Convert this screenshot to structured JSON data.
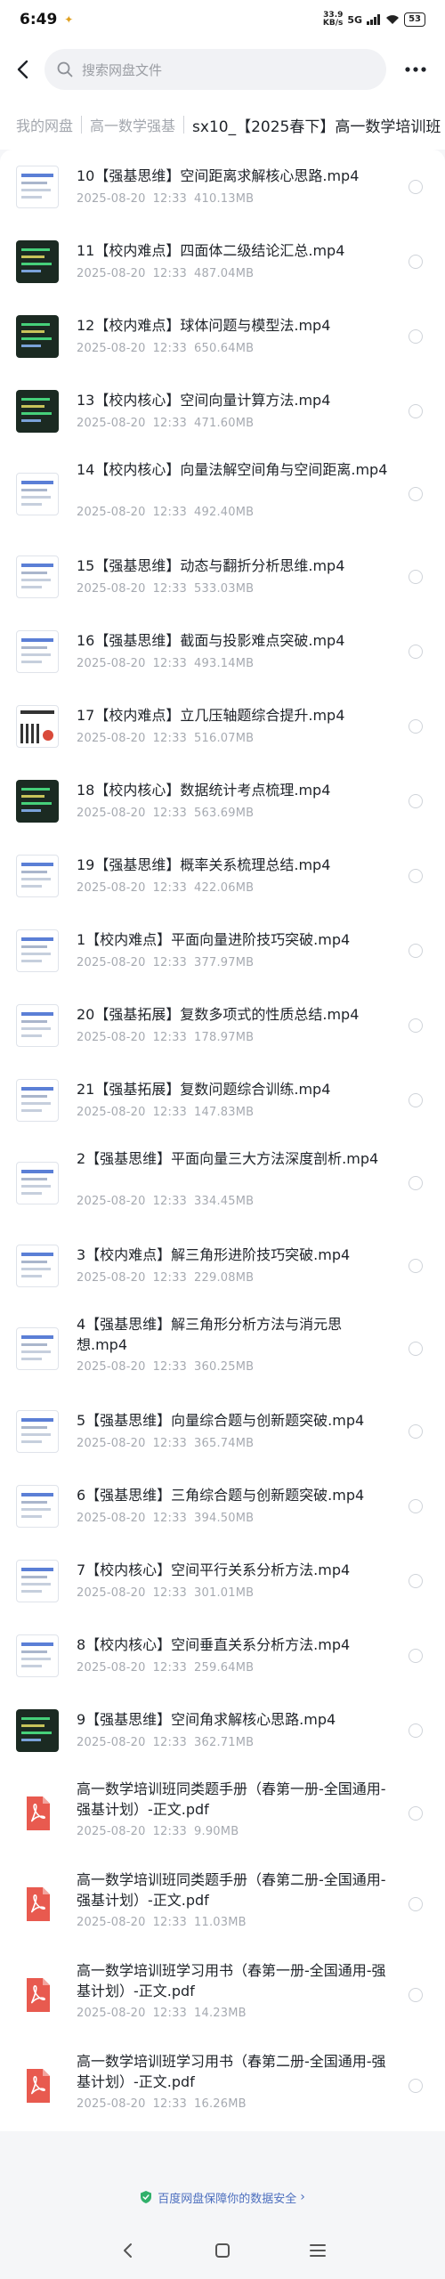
{
  "status": {
    "time": "6:49",
    "net_speed_top": "33.9",
    "net_speed_bottom": "KB/s",
    "signal": "5G",
    "battery": "53"
  },
  "search": {
    "placeholder": "搜索网盘文件"
  },
  "breadcrumb": {
    "items": [
      "我的网盘",
      "高一数学强基"
    ],
    "current": "sx10_【2025春下】高一数学培训班"
  },
  "files": [
    {
      "name": "10【强基思维】空间距离求解核心思路.mp4",
      "date": "2025-08-20",
      "time": "12:33",
      "size": "410.13MB",
      "thumb": "doc"
    },
    {
      "name": "11【校内难点】四面体二级结论汇总.mp4",
      "date": "2025-08-20",
      "time": "12:33",
      "size": "487.04MB",
      "thumb": "dark"
    },
    {
      "name": "12【校内难点】球体问题与模型法.mp4",
      "date": "2025-08-20",
      "time": "12:33",
      "size": "650.64MB",
      "thumb": "dark"
    },
    {
      "name": "13【校内核心】空间向量计算方法.mp4",
      "date": "2025-08-20",
      "time": "12:33",
      "size": "471.60MB",
      "thumb": "dark"
    },
    {
      "name": "14【校内核心】向量法解空间角与空间距离.mp4",
      "date": "2025-08-20",
      "time": "12:33",
      "size": "492.40MB",
      "thumb": "doc"
    },
    {
      "name": "15【强基思维】动态与翻折分析思维.mp4",
      "date": "2025-08-20",
      "time": "12:33",
      "size": "533.03MB",
      "thumb": "doc"
    },
    {
      "name": "16【强基思维】截面与投影难点突破.mp4",
      "date": "2025-08-20",
      "time": "12:33",
      "size": "493.14MB",
      "thumb": "doc"
    },
    {
      "name": "17【校内难点】立几压轴题综合提升.mp4",
      "date": "2025-08-20",
      "time": "12:33",
      "size": "516.07MB",
      "thumb": "qr"
    },
    {
      "name": "18【校内核心】数据统计考点梳理.mp4",
      "date": "2025-08-20",
      "time": "12:33",
      "size": "563.69MB",
      "thumb": "dark"
    },
    {
      "name": "19【强基思维】概率关系梳理总结.mp4",
      "date": "2025-08-20",
      "time": "12:33",
      "size": "422.06MB",
      "thumb": "doc"
    },
    {
      "name": "1【校内难点】平面向量进阶技巧突破.mp4",
      "date": "2025-08-20",
      "time": "12:33",
      "size": "377.97MB",
      "thumb": "doc"
    },
    {
      "name": "20【强基拓展】复数多项式的性质总结.mp4",
      "date": "2025-08-20",
      "time": "12:33",
      "size": "178.97MB",
      "thumb": "doc"
    },
    {
      "name": "21【强基拓展】复数问题综合训练.mp4",
      "date": "2025-08-20",
      "time": "12:33",
      "size": "147.83MB",
      "thumb": "doc"
    },
    {
      "name": "2【强基思维】平面向量三大方法深度剖析.mp4",
      "date": "2025-08-20",
      "time": "12:33",
      "size": "334.45MB",
      "thumb": "doc"
    },
    {
      "name": "3【校内难点】解三角形进阶技巧突破.mp4",
      "date": "2025-08-20",
      "time": "12:33",
      "size": "229.08MB",
      "thumb": "doc"
    },
    {
      "name": "4【强基思维】解三角形分析方法与消元思想.mp4",
      "date": "2025-08-20",
      "time": "12:33",
      "size": "360.25MB",
      "thumb": "doc"
    },
    {
      "name": "5【强基思维】向量综合题与创新题突破.mp4",
      "date": "2025-08-20",
      "time": "12:33",
      "size": "365.74MB",
      "thumb": "doc"
    },
    {
      "name": "6【强基思维】三角综合题与创新题突破.mp4",
      "date": "2025-08-20",
      "time": "12:33",
      "size": "394.50MB",
      "thumb": "doc"
    },
    {
      "name": "7【校内核心】空间平行关系分析方法.mp4",
      "date": "2025-08-20",
      "time": "12:33",
      "size": "301.01MB",
      "thumb": "doc"
    },
    {
      "name": "8【校内核心】空间垂直关系分析方法.mp4",
      "date": "2025-08-20",
      "time": "12:33",
      "size": "259.64MB",
      "thumb": "doc"
    },
    {
      "name": "9【强基思维】空间角求解核心思路.mp4",
      "date": "2025-08-20",
      "time": "12:33",
      "size": "362.71MB",
      "thumb": "dark"
    },
    {
      "name": "高一数学培训班同类题手册（春第一册-全国通用-强基计划）-正文.pdf",
      "date": "2025-08-20",
      "time": "12:33",
      "size": "9.90MB",
      "thumb": "pdf"
    },
    {
      "name": "高一数学培训班同类题手册（春第二册-全国通用-强基计划）-正文.pdf",
      "date": "2025-08-20",
      "time": "12:33",
      "size": "11.03MB",
      "thumb": "pdf"
    },
    {
      "name": "高一数学培训班学习用书（春第一册-全国通用-强基计划）-正文.pdf",
      "date": "2025-08-20",
      "time": "12:33",
      "size": "14.23MB",
      "thumb": "pdf"
    },
    {
      "name": "高一数学培训班学习用书（春第二册-全国通用-强基计划）-正文.pdf",
      "date": "2025-08-20",
      "time": "12:33",
      "size": "16.26MB",
      "thumb": "pdf"
    }
  ],
  "footer": {
    "text": "百度网盘保障你的数据安全"
  },
  "colors": {
    "accent": "#4d6fbe",
    "pdf_red": "#e85a4f",
    "shield_green": "#31b06a"
  },
  "icons": [
    "back-arrow-icon",
    "search-icon",
    "more-icon",
    "shield-icon",
    "nav-back-icon",
    "nav-home-icon",
    "nav-menu-icon"
  ]
}
